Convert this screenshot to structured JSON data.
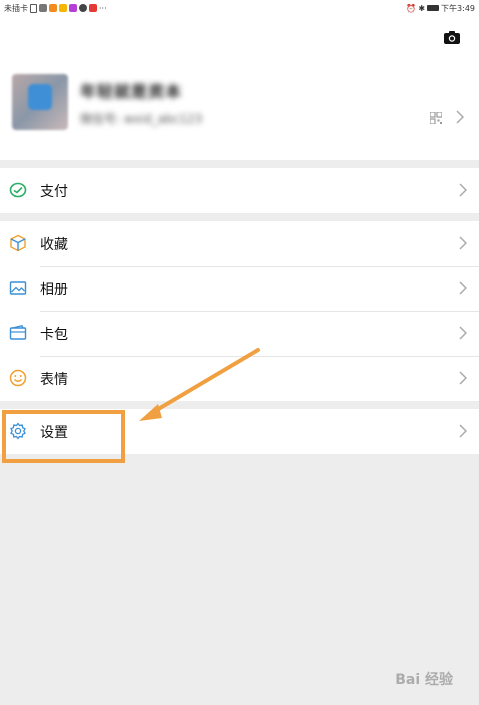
{
  "status_bar": {
    "carrier": "未插卡",
    "time": "下午3:49"
  },
  "profile": {
    "nickname": "年轻就是资本",
    "wechat_id": "微信号: wxid_abc123"
  },
  "menu": {
    "pay": "支付",
    "favorites": "收藏",
    "album": "相册",
    "cards": "卡包",
    "stickers": "表情",
    "settings": "设置"
  },
  "colors": {
    "highlight": "#f0a040",
    "pay_icon": "#2aae67",
    "settings_icon": "#3b8fd6"
  },
  "watermark": "Bai 经验"
}
